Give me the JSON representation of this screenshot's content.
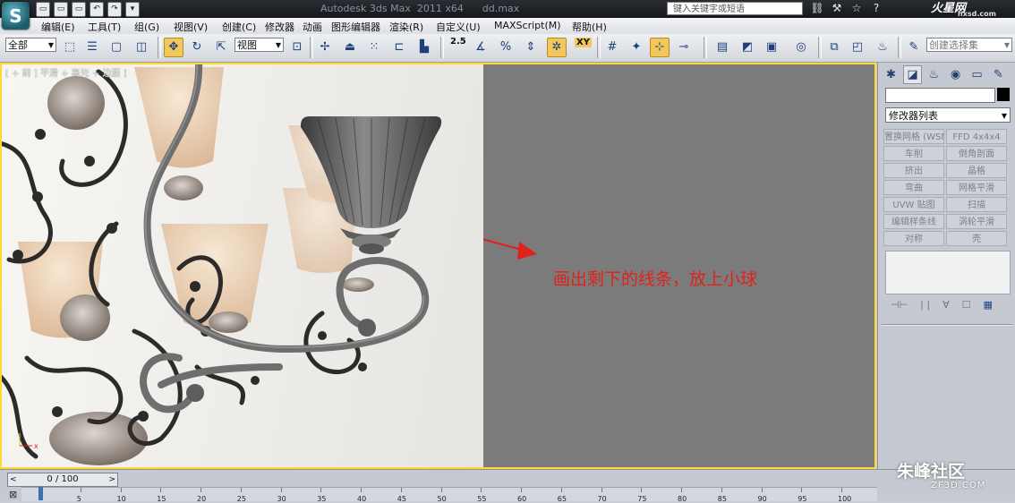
{
  "app": {
    "title": "Autodesk 3ds Max  2011 x64      dd.max",
    "logo_letter": "S",
    "search_placeholder": "键入关键字或短语",
    "brand_logo_text": "火星网",
    "brand_logo_sub": "hxsd.com"
  },
  "quick_access": [
    "▭",
    "▭",
    "▭",
    "↶",
    "↷",
    "▾"
  ],
  "title_icons": [
    "⛓",
    "⚒",
    "☆",
    "?"
  ],
  "menu": [
    {
      "label": "编辑(E)"
    },
    {
      "label": "工具(T)"
    },
    {
      "label": "组(G)"
    },
    {
      "label": "视图(V)"
    },
    {
      "label": "创建(C)"
    },
    {
      "label": "修改器"
    },
    {
      "label": "动画"
    },
    {
      "label": "图形编辑器"
    },
    {
      "label": "渲染(R)"
    },
    {
      "label": "自定义(U)"
    },
    {
      "label": "MAXScript(M)"
    },
    {
      "label": "帮助(H)"
    }
  ],
  "toolbar": {
    "selection_filter": "全部",
    "reference_coord": "视图",
    "snap_angle_label": "2.5",
    "xy_label": "XY",
    "named_selection_placeholder": "创建选择集",
    "move_tool_active": true
  },
  "viewport": {
    "label": "[ + 前 ] 平滑 + 高光 + 边面 ]",
    "annotation": "画出剩下的线条，放上小球",
    "colors": {
      "annotation": "#e0221b",
      "border": "#ffd832",
      "right_bg": "#7b7b7b"
    }
  },
  "command_panel": {
    "tabs": [
      "✱",
      "◪",
      "♨",
      "◉",
      "▭",
      "✎"
    ],
    "modifier_list": "修改器列表",
    "modifier_buttons": [
      "置换网格 (WSM)",
      "FFD 4x4x4",
      "车削",
      "倒角剖面",
      "挤出",
      "晶格",
      "弯曲",
      "网格平滑",
      "UVW 贴图",
      "扫描",
      "编辑样条线",
      "涡轮平滑",
      "对称",
      "壳"
    ],
    "stack_tools": [
      "⊣⊢",
      "| |",
      "∀",
      "☐",
      "▦"
    ]
  },
  "timeline": {
    "slider_label": "0 / 100",
    "prev": "<",
    "next": ">",
    "ticks": [
      0,
      5,
      10,
      15,
      20,
      25,
      30,
      35,
      40,
      45,
      50,
      55,
      60,
      65,
      70,
      75,
      80,
      85,
      90,
      95,
      100
    ],
    "current_frame": 0
  },
  "watermark": {
    "text": "朱峰社区",
    "sub": "ZF3D.COM"
  }
}
